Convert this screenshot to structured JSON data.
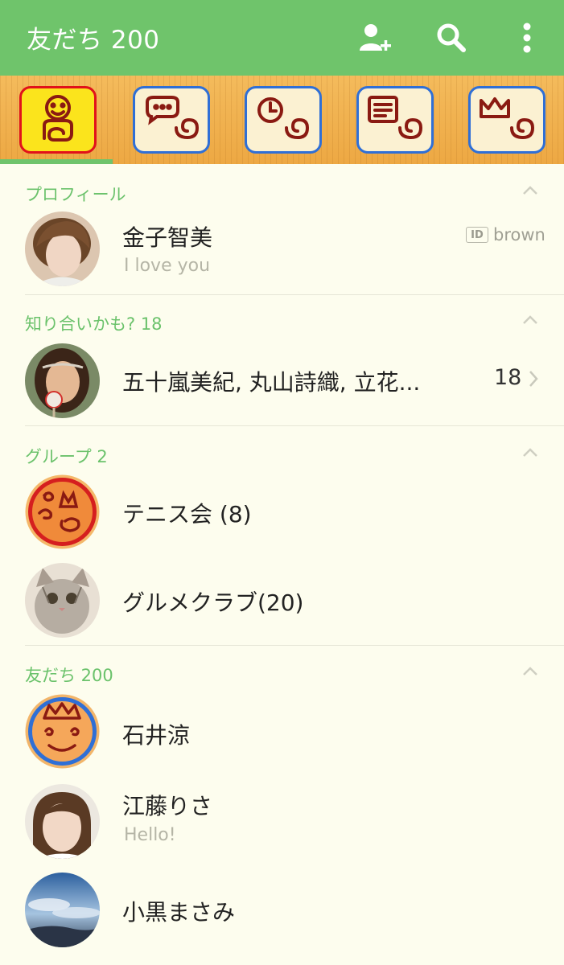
{
  "header": {
    "title": "友だち 200",
    "icons": [
      "add-friend-icon",
      "search-icon",
      "more-vertical-icon"
    ]
  },
  "tabs": [
    {
      "name": "friends",
      "icon": "friends-icon",
      "active": true
    },
    {
      "name": "chats",
      "icon": "chat-bubble-icon",
      "active": false
    },
    {
      "name": "timeline",
      "icon": "clock-icon",
      "active": false
    },
    {
      "name": "news",
      "icon": "news-icon",
      "active": false
    },
    {
      "name": "more",
      "icon": "crown-icon",
      "active": false
    }
  ],
  "profile": {
    "section_label": "プロフィール",
    "name": "金子智美",
    "status": "I love you",
    "id_label": "ID",
    "id_value": "brown"
  },
  "suggestions": {
    "section_label": "知り合いかも? 18",
    "names": "五十嵐美紀, 丸山詩織, 立花...",
    "count": "18"
  },
  "groups": {
    "section_label": "グループ  2",
    "items": [
      {
        "name": "テニス会 (8)"
      },
      {
        "name": "グルメクラブ(20)"
      }
    ]
  },
  "friends": {
    "section_label": "友だち 200",
    "items": [
      {
        "name": "石井涼",
        "status": ""
      },
      {
        "name": "江藤りさ",
        "status": "Hello!"
      },
      {
        "name": "小黒まさみ",
        "status": ""
      }
    ]
  },
  "colors": {
    "header_bg": "#6fc46b",
    "section_label": "#6bc26b",
    "background": "#fdfdee",
    "tab_active_border": "#e1121a",
    "tab_border": "#2f6fd6",
    "tab_active_bg": "#fbe41c"
  }
}
